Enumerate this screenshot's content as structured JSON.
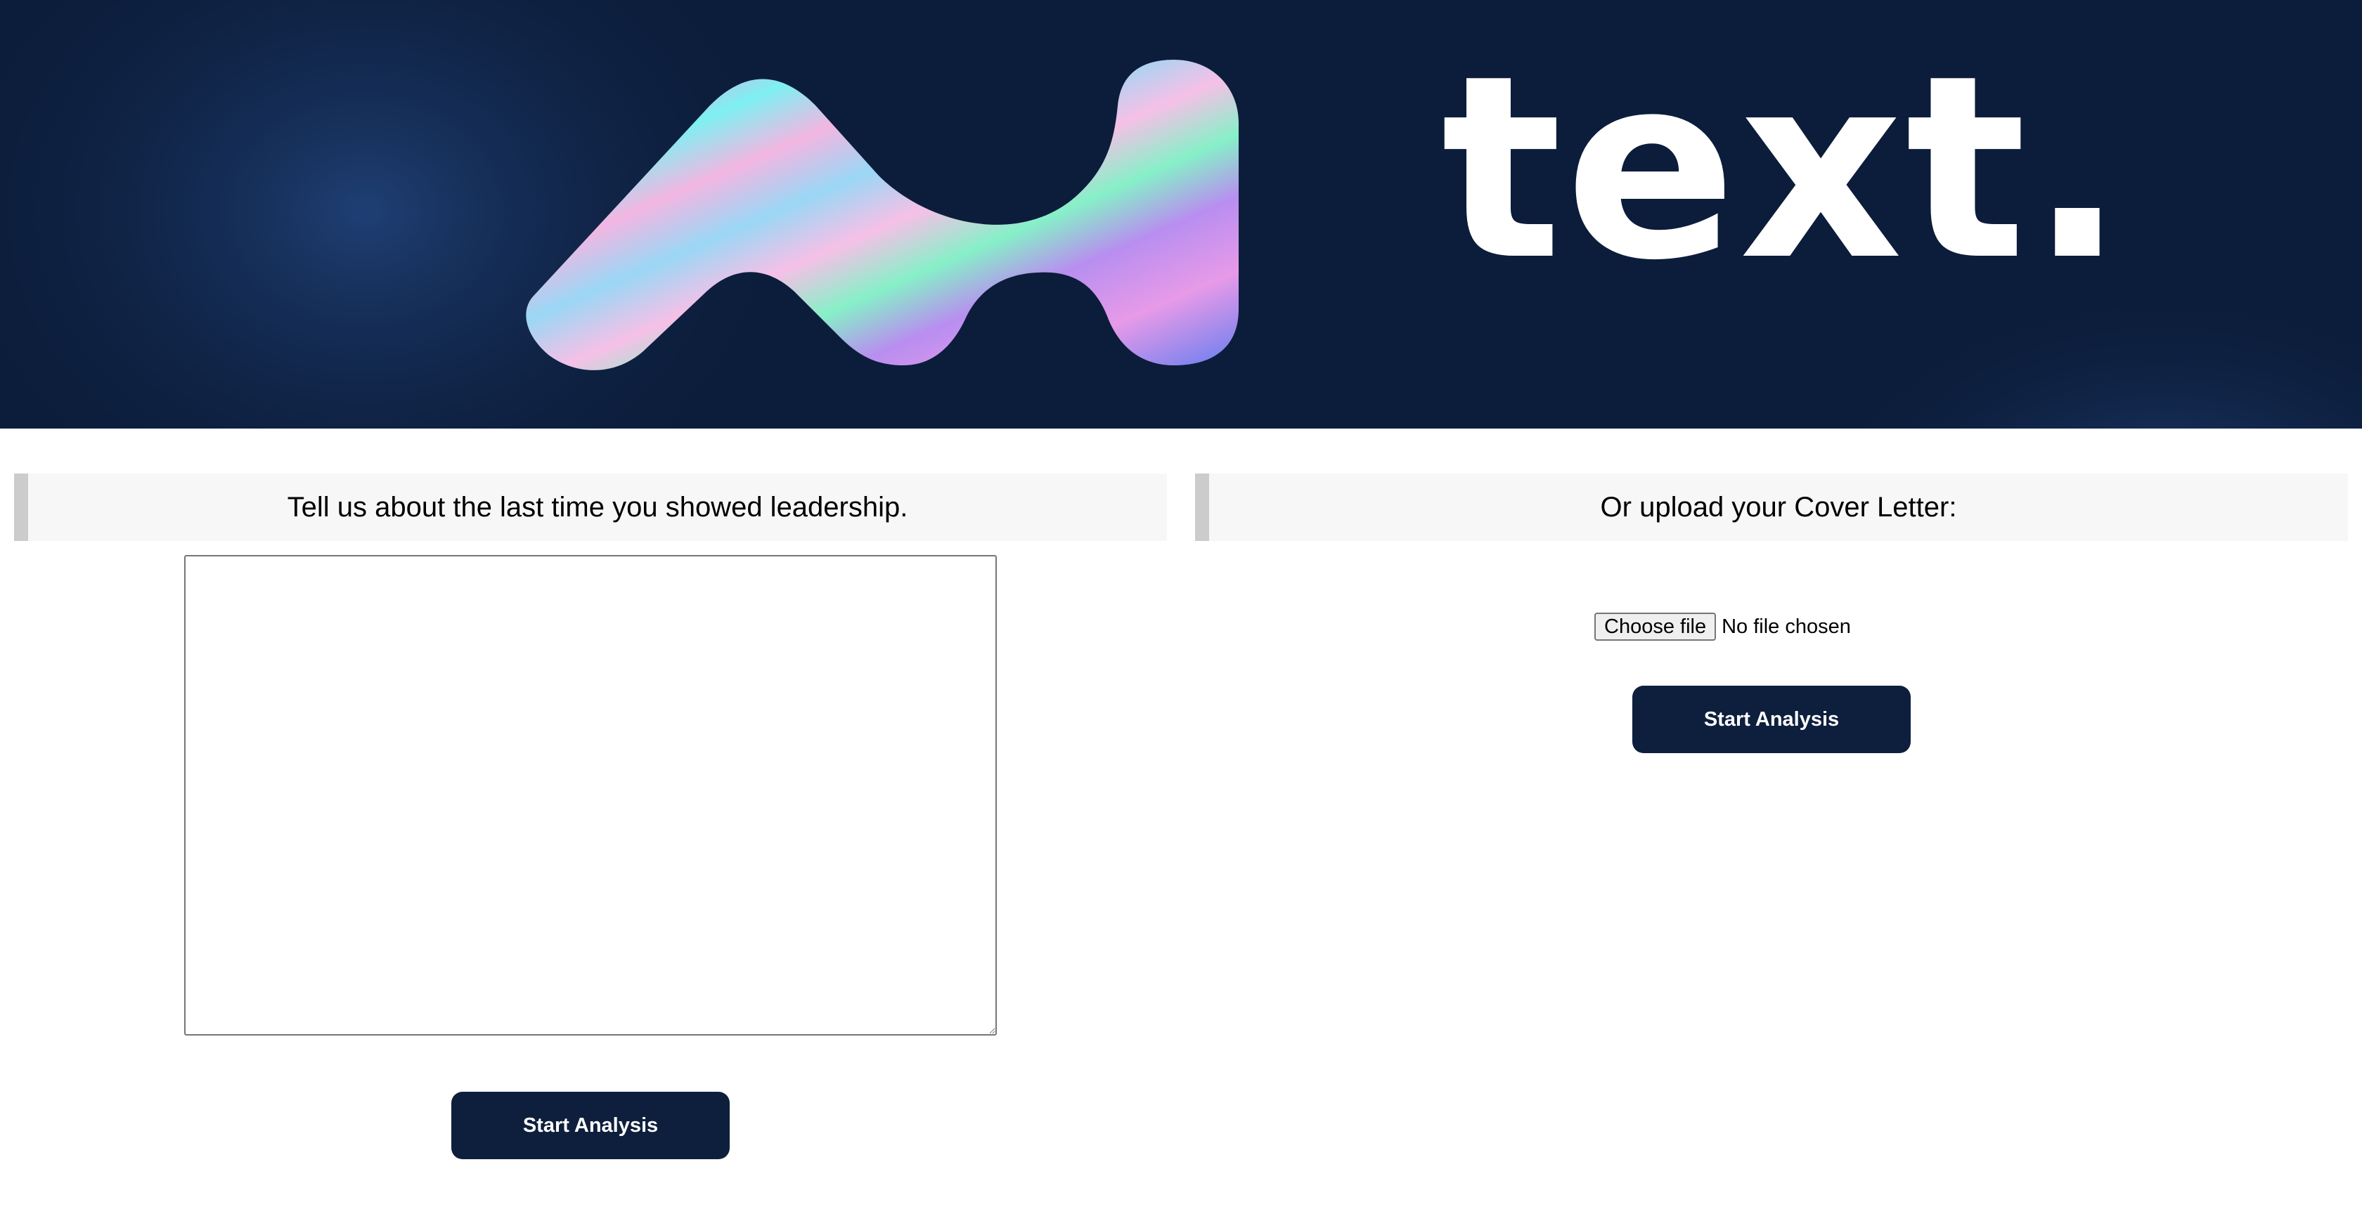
{
  "banner": {
    "brand_text": "text."
  },
  "left": {
    "prompt": "Tell us about the last time you showed leadership.",
    "answer_value": "",
    "button_label": "Start Analysis"
  },
  "right": {
    "prompt": "Or upload your Cover Letter:",
    "file_button_label": "Choose file",
    "file_status": "No file chosen",
    "button_label": "Start Analysis"
  },
  "colors": {
    "banner_bg": "#0c1d3b",
    "button_bg": "#0d1f3c",
    "prompt_bg": "#f7f7f7",
    "prompt_border": "#cccccc"
  }
}
